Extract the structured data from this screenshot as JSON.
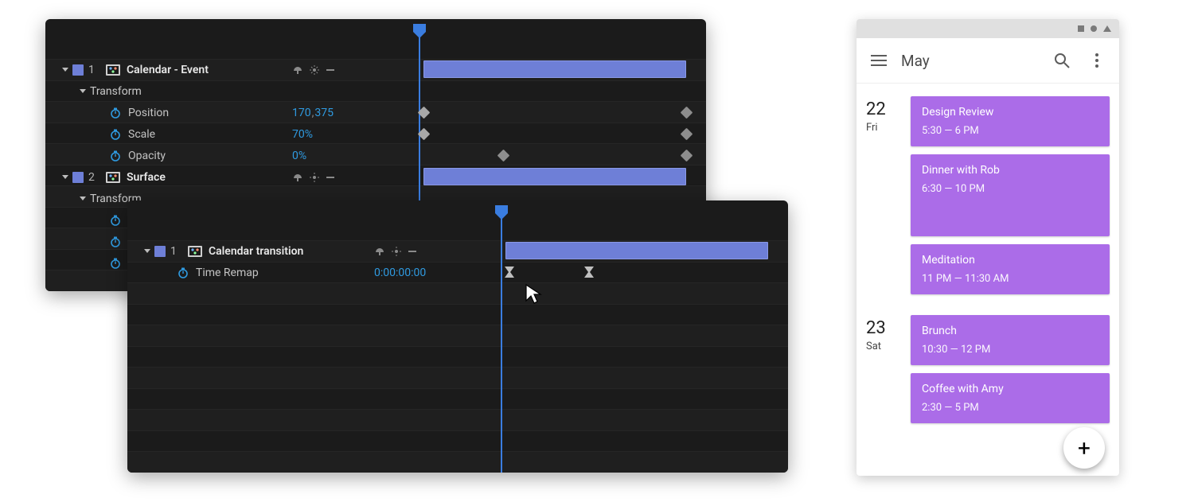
{
  "panels": {
    "back": {
      "layers": [
        {
          "index": "1",
          "name": "Calendar - Event",
          "group": "Transform",
          "props": {
            "position": {
              "label": "Position",
              "x": "170",
              "y": "375"
            },
            "scale": {
              "label": "Scale",
              "value": "70%"
            },
            "opacity": {
              "label": "Opacity",
              "value": "0%"
            }
          }
        },
        {
          "index": "2",
          "name": "Surface",
          "group": "Transform"
        }
      ]
    },
    "front": {
      "layer": {
        "index": "1",
        "name": "Calendar transition",
        "prop": {
          "label": "Time Remap",
          "value": "0:00:00:00"
        }
      }
    }
  },
  "phone": {
    "appbar": {
      "title": "May"
    },
    "days": [
      {
        "num": "22",
        "dow": "Fri",
        "events": [
          {
            "title": "Design Review",
            "time": "5:30 — 6 PM",
            "size": "normal"
          },
          {
            "title": "Dinner with Rob",
            "time": "6:30 — 10 PM",
            "size": "xtall"
          },
          {
            "title": "Meditation",
            "time": "11 PM — 11:30 AM",
            "size": "normal"
          }
        ]
      },
      {
        "num": "23",
        "dow": "Sat",
        "events": [
          {
            "title": "Brunch",
            "time": "10:30 — 12 PM",
            "size": "normal"
          },
          {
            "title": "Coffee with Amy",
            "time": "2:30 — 5 PM",
            "size": "normal"
          }
        ]
      }
    ],
    "fab": "+"
  }
}
